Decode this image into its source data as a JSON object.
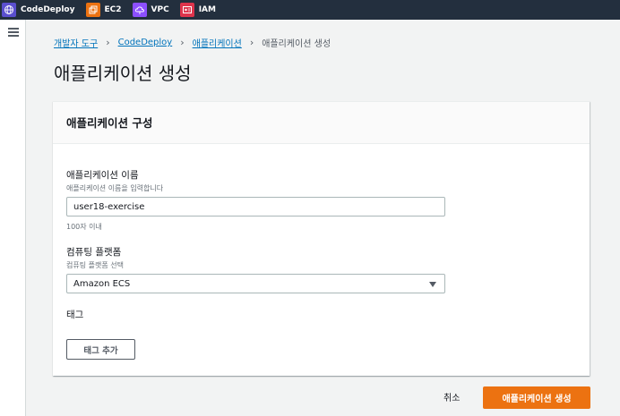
{
  "topnav": {
    "services": [
      {
        "label": "CodeDeploy",
        "icon": "globe-icon",
        "color": "#5a4fcf"
      },
      {
        "label": "EC2",
        "icon": "ec2-chip-icon",
        "color": "#ec7211"
      },
      {
        "label": "VPC",
        "icon": "vpc-cloud-icon",
        "color": "#8c4fff"
      },
      {
        "label": "IAM",
        "icon": "iam-badge-icon",
        "color": "#dd344c"
      }
    ]
  },
  "breadcrumb": {
    "items": [
      "개발자 도구",
      "CodeDeploy",
      "애플리케이션"
    ],
    "current": "애플리케이션 생성"
  },
  "page": {
    "title": "애플리케이션 생성"
  },
  "card": {
    "title": "애플리케이션 구성",
    "app_name": {
      "label": "애플리케이션 이름",
      "description": "애플리케이션 이름을 입력합니다",
      "value": "user18-exercise",
      "constraint": "100자 이내"
    },
    "platform": {
      "label": "컴퓨팅 플랫폼",
      "description": "컴퓨팅 플랫폼 선택",
      "value": "Amazon ECS"
    },
    "tags": {
      "label": "태그",
      "add_button": "태그 추가"
    }
  },
  "footer": {
    "cancel": "취소",
    "submit": "애플리케이션 생성"
  },
  "colors": {
    "nav_bg": "#232f3e",
    "link": "#0073bb",
    "primary": "#ec7211"
  }
}
